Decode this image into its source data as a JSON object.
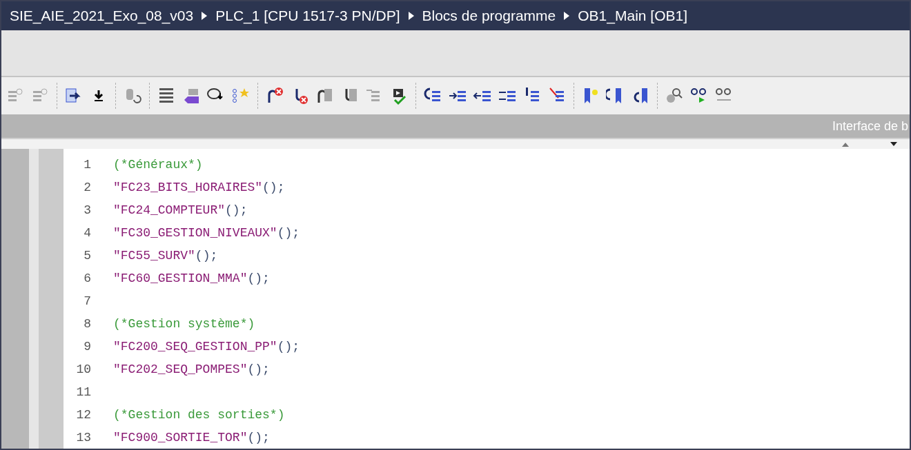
{
  "breadcrumb": [
    "SIE_AIE_2021_Exo_08_v03",
    "PLC_1 [CPU 1517-3 PN/DP]",
    "Blocs de programme",
    "OB1_Main [OB1]"
  ],
  "interface_header": "Interface de b",
  "code_lines": [
    {
      "number": "1",
      "kind": "comment",
      "text": "(*Généraux*)"
    },
    {
      "number": "2",
      "kind": "call",
      "text": "\"FC23_BITS_HORAIRES\"",
      "suffix": "();"
    },
    {
      "number": "3",
      "kind": "call",
      "text": "\"FC24_COMPTEUR\"",
      "suffix": "();"
    },
    {
      "number": "4",
      "kind": "call",
      "text": "\"FC30_GESTION_NIVEAUX\"",
      "suffix": "();"
    },
    {
      "number": "5",
      "kind": "call",
      "text": "\"FC55_SURV\"",
      "suffix": "();"
    },
    {
      "number": "6",
      "kind": "call",
      "text": "\"FC60_GESTION_MMA\"",
      "suffix": "();"
    },
    {
      "number": "7",
      "kind": "blank"
    },
    {
      "number": "8",
      "kind": "comment",
      "text": "(*Gestion système*)"
    },
    {
      "number": "9",
      "kind": "call",
      "text": "\"FC200_SEQ_GESTION_PP\"",
      "suffix": "();"
    },
    {
      "number": "10",
      "kind": "call",
      "text": "\"FC202_SEQ_POMPES\"",
      "suffix": "();"
    },
    {
      "number": "11",
      "kind": "blank"
    },
    {
      "number": "12",
      "kind": "comment",
      "text": "(*Gestion des sorties*)"
    },
    {
      "number": "13",
      "kind": "call",
      "text": "\"FC900_SORTIE_TOR\"",
      "suffix": "();"
    }
  ]
}
